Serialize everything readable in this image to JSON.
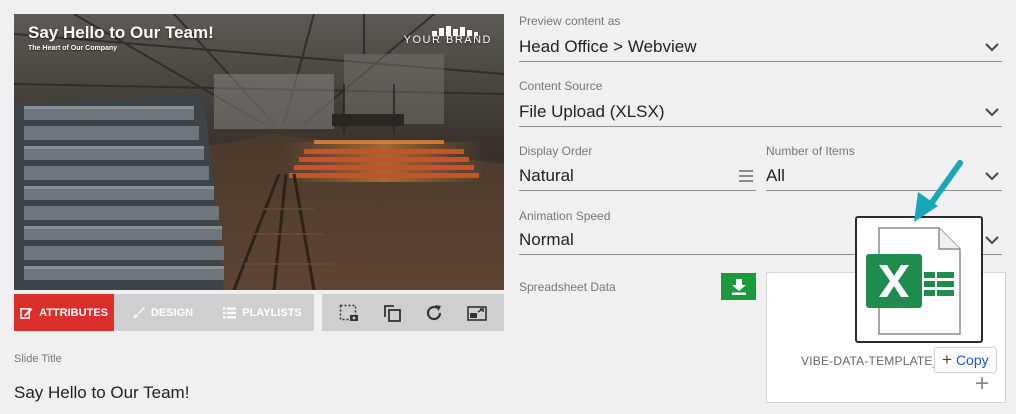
{
  "preview": {
    "title": "Say Hello to Our Team!",
    "subtitle": "The Heart of Our Company",
    "brand": "YOUR BRAND"
  },
  "tabs": [
    {
      "label": "ATTRIBUTES",
      "icon": "edit-icon",
      "active": true
    },
    {
      "label": "DESIGN",
      "icon": "brush-icon",
      "active": false
    },
    {
      "label": "PLAYLISTS",
      "icon": "list-icon",
      "active": false
    }
  ],
  "tools": [
    "screenshot-icon",
    "duplicate-icon",
    "refresh-icon",
    "fullscreen-icon"
  ],
  "slide_title": {
    "label": "Slide Title",
    "value": "Say Hello to Our Team!"
  },
  "fields": {
    "preview_as": {
      "label": "Preview content as",
      "value": "Head Office > Webview"
    },
    "content_source": {
      "label": "Content Source",
      "value": "File Upload (XLSX)"
    },
    "display_order": {
      "label": "Display Order",
      "value": "Natural"
    },
    "number_of_items": {
      "label": "Number of Items",
      "value": "All"
    },
    "animation_speed": {
      "label": "Animation Speed",
      "value": "Normal"
    }
  },
  "spreadsheet": {
    "label": "Spreadsheet Data",
    "filename": "VIBE-DATA-TEMPLATE_E",
    "copy_label": "Copy",
    "add_symbol": "+"
  },
  "colors": {
    "accent_red": "#d9302b",
    "download_green": "#1a9a3c",
    "arrow_teal": "#1aa7b5",
    "excel_green": "#1f8c4e"
  }
}
